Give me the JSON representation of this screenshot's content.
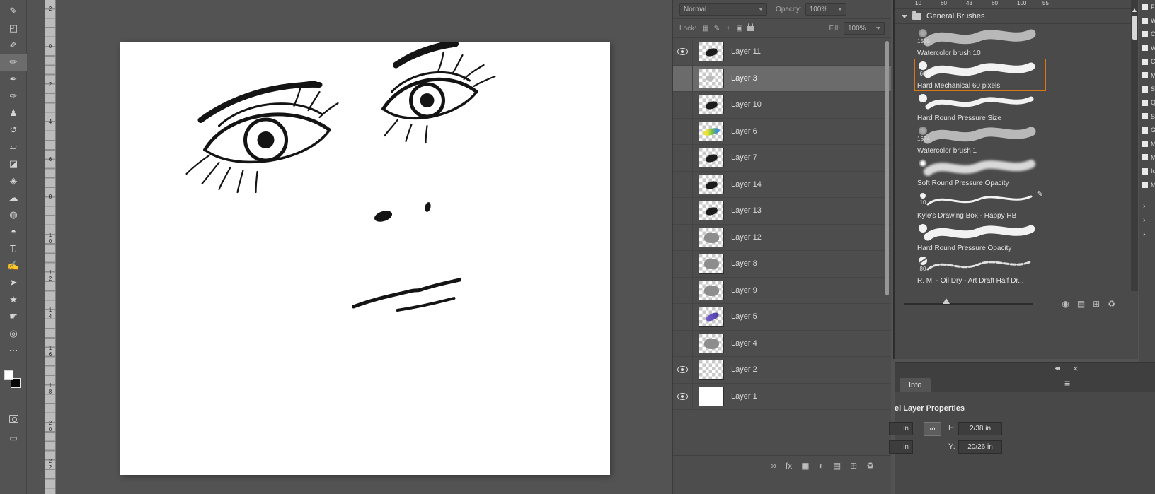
{
  "toolbar": {
    "tools": [
      {
        "id": "curvature-pen-tool",
        "glyph": "✎"
      },
      {
        "id": "crop-tool",
        "glyph": "◰"
      },
      {
        "id": "eyedropper-tool",
        "glyph": "✐"
      },
      {
        "id": "brush-tool",
        "glyph": "✏",
        "active": true
      },
      {
        "id": "pencil-tool",
        "glyph": "✒"
      },
      {
        "id": "mixer-brush-tool",
        "glyph": "✑"
      },
      {
        "id": "clone-stamp-tool",
        "glyph": "♟"
      },
      {
        "id": "history-brush-tool",
        "glyph": "↺"
      },
      {
        "id": "eraser-tool",
        "glyph": "▱"
      },
      {
        "id": "gradient-tool",
        "glyph": "◪"
      },
      {
        "id": "paint-bucket-tool",
        "glyph": "◈"
      },
      {
        "id": "blur-tool",
        "glyph": "☁"
      },
      {
        "id": "smudge-tool",
        "glyph": "◍"
      },
      {
        "id": "dodge-tool",
        "glyph": "◓"
      },
      {
        "id": "type-tool",
        "glyph": "T."
      },
      {
        "id": "pen-tool",
        "glyph": "✍"
      },
      {
        "id": "path-selection-tool",
        "glyph": "➤"
      },
      {
        "id": "custom-shape-tool",
        "glyph": "★"
      },
      {
        "id": "hand-tool",
        "glyph": "☛"
      },
      {
        "id": "zoom-tool",
        "glyph": "◎"
      },
      {
        "id": "edit-toolbar-button",
        "glyph": "⋯"
      }
    ],
    "screen_mode_glyph": "▭",
    "fg_color": "#ffffff",
    "bg_color": "#000000"
  },
  "ruler": {
    "numbers": [
      "2",
      "0",
      "2",
      "4",
      "6",
      "8",
      "1\n0",
      "1\n2",
      "1\n4",
      "1\n6",
      "1\n8",
      "2\n0",
      "2\n2"
    ]
  },
  "layers_panel": {
    "blend_mode": "Normal",
    "opacity_label": "Opacity:",
    "opacity_value": "100%",
    "lock_label": "Lock:",
    "lock_icons": [
      "▦",
      "✎",
      "+",
      "▣"
    ],
    "fill_label": "Fill:",
    "fill_value": "100%",
    "layers": [
      {
        "name": "Layer 11",
        "visible": true,
        "thumb": "dark"
      },
      {
        "name": "Layer 3",
        "visible": false,
        "selected": true,
        "thumb": "faint"
      },
      {
        "name": "Layer 10",
        "visible": false,
        "thumb": "dark"
      },
      {
        "name": "Layer 6",
        "visible": false,
        "thumb": "color"
      },
      {
        "name": "Layer 7",
        "visible": false,
        "thumb": "dark"
      },
      {
        "name": "Layer 14",
        "visible": false,
        "thumb": "dark"
      },
      {
        "name": "Layer 13",
        "visible": false,
        "thumb": "dark"
      },
      {
        "name": "Layer 12",
        "visible": false,
        "thumb": "gray"
      },
      {
        "name": "Layer 8",
        "visible": false,
        "thumb": "gray"
      },
      {
        "name": "Layer 9",
        "visible": false,
        "thumb": "gray"
      },
      {
        "name": "Layer 5",
        "visible": false,
        "thumb": "purple"
      },
      {
        "name": "Layer 4",
        "visible": false,
        "thumb": "gray"
      },
      {
        "name": "Layer 2",
        "visible": true,
        "thumb": "empty"
      },
      {
        "name": "Layer 1",
        "visible": true,
        "thumb": "white"
      }
    ],
    "footer_icons": [
      {
        "id": "link-layers-button",
        "glyph": "∞"
      },
      {
        "id": "layer-effects-button",
        "glyph": "fx"
      },
      {
        "id": "layer-mask-button",
        "glyph": "▣"
      },
      {
        "id": "adjustment-layer-button",
        "glyph": "◐"
      },
      {
        "id": "layer-group-button",
        "glyph": "▤"
      },
      {
        "id": "new-layer-button",
        "glyph": "⊞"
      },
      {
        "id": "delete-layer-button",
        "glyph": "♻"
      }
    ]
  },
  "brushes_panel": {
    "top_sizes": [
      "10",
      "60",
      "43",
      "60",
      "100",
      "55"
    ],
    "group_title": "General Brushes",
    "brushes": [
      {
        "name": "Watercolor brush 10",
        "size": "1559",
        "tip": "tip-texture",
        "stroke": "stroke-watercolor"
      },
      {
        "name": "Hard Mechanical 60 pixels",
        "size": "60",
        "tip": "tip-hard",
        "stroke": "stroke-hard",
        "selected": true
      },
      {
        "name": "Hard Round Pressure Size",
        "size": "",
        "tip": "tip-hard",
        "stroke": "stroke-taper"
      },
      {
        "name": "Watercolor brush 1",
        "size": "1674",
        "tip": "tip-texture",
        "stroke": "stroke-watercolor"
      },
      {
        "name": "Soft Round Pressure Opacity",
        "size": "",
        "tip": "tip-soft",
        "stroke": "stroke-soft"
      },
      {
        "name": "Kyle's Drawing Box - Happy HB",
        "size": "10",
        "tip": "tip-small",
        "stroke": "stroke-thin",
        "badge": "✎"
      },
      {
        "name": "Hard Round Pressure Opacity",
        "size": "",
        "tip": "tip-hard",
        "stroke": "stroke-hard"
      },
      {
        "name": "R. M. - Oil Dry - Art Draft Half Dr...",
        "size": "80",
        "tip": "tip-slash",
        "stroke": "stroke-rough"
      }
    ],
    "footer_icons": [
      {
        "id": "brush-stroke-preview-toggle",
        "glyph": "◉"
      },
      {
        "id": "new-brush-group-button",
        "glyph": "▤"
      },
      {
        "id": "new-brush-button",
        "glyph": "⊞"
      },
      {
        "id": "delete-brush-button",
        "glyph": "♻"
      }
    ]
  },
  "right_strip": {
    "items": [
      "Fro",
      "Wod",
      "Cast",
      "Wat",
      "Cust",
      "Mob",
      "Sep",
      "Qua",
      "Sav",
      "Gra",
      "Mix",
      "Mo",
      "Idea",
      "Moti"
    ],
    "chevrons": [
      "›",
      "›",
      "›"
    ]
  },
  "info_panel": {
    "collapse_icon": "◂◂",
    "close_icon": "×",
    "tab_label": "Info",
    "menu_icon": "≡",
    "section_title": "el Layer Properties",
    "link_icon": "∞",
    "row1": {
      "unit": "in",
      "label": "H:",
      "value": "2/38 in"
    },
    "row2": {
      "unit": "in",
      "label": "Y:",
      "value": "20/26 in"
    }
  }
}
